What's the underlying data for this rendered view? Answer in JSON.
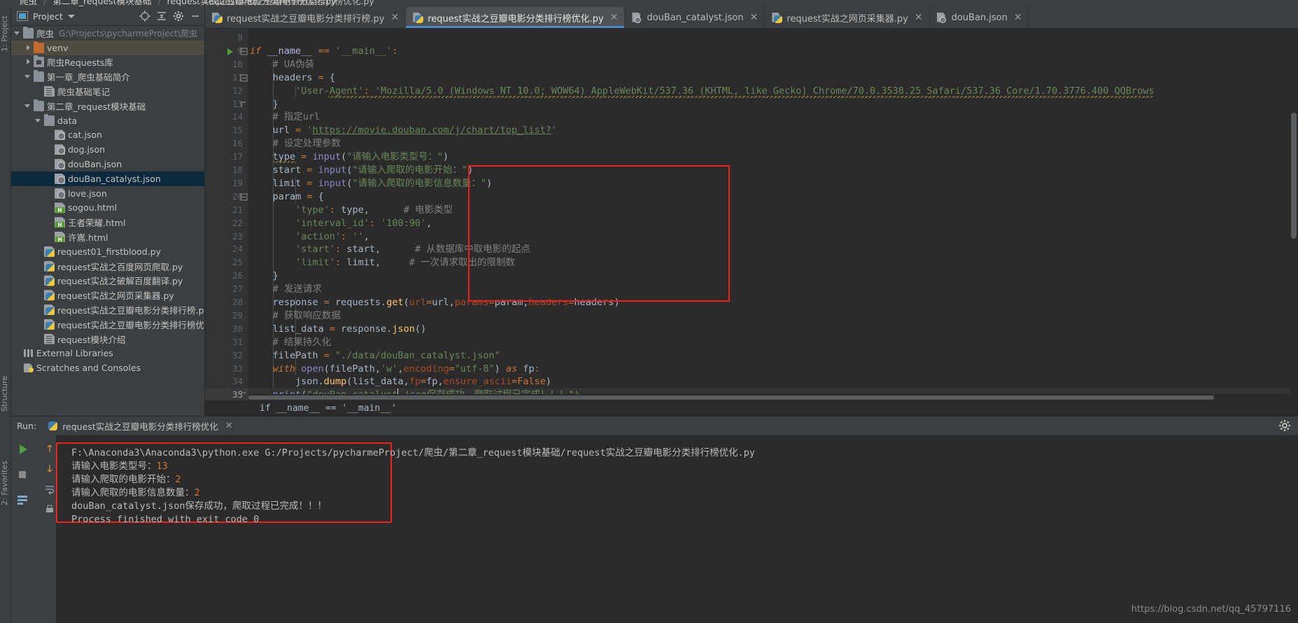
{
  "window": {
    "breadcrumb_top": [
      "爬虫",
      "第二章_request模块基础",
      "request实战之豆瓣电影分类排行榜优化.py"
    ],
    "partial_tab_text": "request实战之豆瓣电影分类排行榜优化.py"
  },
  "project_panel": {
    "title": "Project",
    "toolbar_icons": [
      "locate-icon",
      "collapse-all-icon",
      "gear-icon",
      "minimize-icon"
    ],
    "tree": [
      {
        "indent": 0,
        "arrow": "down",
        "icon": "folder-icon",
        "label": "爬虫",
        "path": "G:\\Projects\\pycharmeProject\\爬虫",
        "state": ""
      },
      {
        "indent": 1,
        "arrow": "right",
        "icon": "folder-orange-icon",
        "label": "venv",
        "path": "",
        "state": "sel-orange"
      },
      {
        "indent": 1,
        "arrow": "right",
        "icon": "folder-source-icon",
        "label": "爬虫Requests库",
        "path": "",
        "state": ""
      },
      {
        "indent": 1,
        "arrow": "down",
        "icon": "folder-icon",
        "label": "第一章_爬虫基础简介",
        "path": "",
        "state": ""
      },
      {
        "indent": 2,
        "arrow": "none",
        "icon": "text-file-icon",
        "label": "爬虫基础笔记",
        "path": "",
        "state": ""
      },
      {
        "indent": 1,
        "arrow": "down",
        "icon": "folder-icon",
        "label": "第二章_request模块基础",
        "path": "",
        "state": ""
      },
      {
        "indent": 2,
        "arrow": "down",
        "icon": "folder-icon",
        "label": "data",
        "path": "",
        "state": ""
      },
      {
        "indent": 3,
        "arrow": "none",
        "icon": "json-file-icon",
        "label": "cat.json",
        "path": "",
        "state": ""
      },
      {
        "indent": 3,
        "arrow": "none",
        "icon": "json-file-icon",
        "label": "dog.json",
        "path": "",
        "state": ""
      },
      {
        "indent": 3,
        "arrow": "none",
        "icon": "json-file-icon",
        "label": "douBan.json",
        "path": "",
        "state": ""
      },
      {
        "indent": 3,
        "arrow": "none",
        "icon": "json-file-icon",
        "label": "douBan_catalyst.json",
        "path": "",
        "state": "sel-blue"
      },
      {
        "indent": 3,
        "arrow": "none",
        "icon": "json-file-icon",
        "label": "love.json",
        "path": "",
        "state": ""
      },
      {
        "indent": 3,
        "arrow": "none",
        "icon": "html-file-icon",
        "label": "sogou.html",
        "path": "",
        "state": ""
      },
      {
        "indent": 3,
        "arrow": "none",
        "icon": "html-file-icon",
        "label": "王者荣耀.html",
        "path": "",
        "state": ""
      },
      {
        "indent": 3,
        "arrow": "none",
        "icon": "html-file-icon",
        "label": "许嵩.html",
        "path": "",
        "state": ""
      },
      {
        "indent": 2,
        "arrow": "none",
        "icon": "python-file-icon",
        "label": "request01_firstblood.py",
        "path": "",
        "state": ""
      },
      {
        "indent": 2,
        "arrow": "none",
        "icon": "python-file-icon",
        "label": "request实战之百度网页爬取.py",
        "path": "",
        "state": ""
      },
      {
        "indent": 2,
        "arrow": "none",
        "icon": "python-file-icon",
        "label": "request实战之破解百度翻译.py",
        "path": "",
        "state": ""
      },
      {
        "indent": 2,
        "arrow": "none",
        "icon": "python-file-icon",
        "label": "request实战之网页采集器.py",
        "path": "",
        "state": ""
      },
      {
        "indent": 2,
        "arrow": "none",
        "icon": "python-file-icon",
        "label": "request实战之豆瓣电影分类排行榜.py",
        "path": "",
        "state": ""
      },
      {
        "indent": 2,
        "arrow": "none",
        "icon": "python-file-icon",
        "label": "request实战之豆瓣电影分类排行榜优化.py",
        "path": "",
        "state": ""
      },
      {
        "indent": 2,
        "arrow": "none",
        "icon": "text-file-icon",
        "label": "request模块介绍",
        "path": "",
        "state": ""
      },
      {
        "indent": 0,
        "arrow": "none",
        "icon": "library-icon",
        "label": "External Libraries",
        "path": "",
        "state": ""
      },
      {
        "indent": 0,
        "arrow": "none",
        "icon": "scratch-icon",
        "label": "Scratches and Consoles",
        "path": "",
        "state": ""
      }
    ]
  },
  "left_rail": {
    "project": "1: Project",
    "structure": "Structure",
    "favorites": "2: Favorites"
  },
  "editor_tabs": [
    {
      "label": "request实战之豆瓣电影分类排行榜.py",
      "icon": "python-file-icon",
      "active": false
    },
    {
      "label": "request实战之豆瓣电影分类排行榜优化.py",
      "icon": "python-file-icon",
      "active": true
    },
    {
      "label": "douBan_catalyst.json",
      "icon": "json-file-icon",
      "active": false
    },
    {
      "label": "request实战之网页采集器.py",
      "icon": "python-file-icon",
      "active": false
    },
    {
      "label": "douBan.json",
      "icon": "json-file-icon",
      "active": false
    }
  ],
  "editor": {
    "first_line_number": 8,
    "current_line": 35,
    "breadcrumb": "if __name__ == '__main__'",
    "lines": [
      {
        "n": 8,
        "text": ""
      },
      {
        "n": 9,
        "text": "if __name__ == '__main__':"
      },
      {
        "n": 10,
        "text": "    # UA伪装"
      },
      {
        "n": 11,
        "text": "    headers = {"
      },
      {
        "n": 12,
        "text": "        'User-Agent': 'Mozilla/5.0 (Windows NT 10.0; WOW64) AppleWebKit/537.36 (KHTML, like Gecko) Chrome/70.0.3538.25 Safari/537.36 Core/1.70.3776.400 QQBrows"
      },
      {
        "n": 13,
        "text": "    }"
      },
      {
        "n": 14,
        "text": "    # 指定url"
      },
      {
        "n": 15,
        "text": "    url = 'https://movie.douban.com/j/chart/top_list?'"
      },
      {
        "n": 16,
        "text": "    # 设定处理参数"
      },
      {
        "n": 17,
        "text": "    type = input(\"请输入电影类型号：\")"
      },
      {
        "n": 18,
        "text": "    start = input(\"请输入爬取的电影开始：\")"
      },
      {
        "n": 19,
        "text": "    limit = input(\"请输入爬取的电影信息数量：\")"
      },
      {
        "n": 20,
        "text": "    param = {"
      },
      {
        "n": 21,
        "text": "        'type': type,      # 电影类型"
      },
      {
        "n": 22,
        "text": "        'interval_id': '100:90',"
      },
      {
        "n": 23,
        "text": "        'action': '',"
      },
      {
        "n": 24,
        "text": "        'start': start,      # 从数据库中取电影的起点"
      },
      {
        "n": 25,
        "text": "        'limit': limit,     # 一次请求取出的限制数"
      },
      {
        "n": 26,
        "text": "    }"
      },
      {
        "n": 27,
        "text": "    # 发送请求"
      },
      {
        "n": 28,
        "text": "    response = requests.get(url=url,params=param,headers=headers)"
      },
      {
        "n": 29,
        "text": "    # 获取响应数据"
      },
      {
        "n": 30,
        "text": "    list_data = response.json()"
      },
      {
        "n": 31,
        "text": "    # 结果持久化"
      },
      {
        "n": 32,
        "text": "    filePath = \"./data/douBan_catalyst.json\""
      },
      {
        "n": 33,
        "text": "    with open(filePath,'w',encoding=\"utf-8\") as fp:"
      },
      {
        "n": 34,
        "text": "        json.dump(list_data,fp=fp,ensure_ascii=False)"
      },
      {
        "n": 35,
        "text": "    print(\"douBan_catalyst.json保存成功，爬取过程已完成！！！\")"
      },
      {
        "n": 36,
        "text": ""
      }
    ]
  },
  "run_panel": {
    "run_label": "Run:",
    "tab_label": "request实战之豆瓣电影分类排行榜优化",
    "left_buttons": [
      "run-icon",
      "stop-icon",
      "rerun-icon",
      "scroll-up-icon",
      "scroll-down-icon",
      "soft-wrap-icon",
      "print-icon"
    ],
    "gear_icon": "settings-icon",
    "console": [
      {
        "kind": "cmd",
        "text": "F:\\Anaconda3\\Anaconda3\\python.exe G:/Projects/pycharmeProject/爬虫/第二章_request模块基础/request实战之豆瓣电影分类排行榜优化.py"
      },
      {
        "kind": "prompt",
        "text": "请输入电影类型号：",
        "value": "13"
      },
      {
        "kind": "prompt",
        "text": "请输入爬取的电影开始：",
        "value": "2"
      },
      {
        "kind": "prompt",
        "text": "请输入爬取的电影信息数量：",
        "value": "2"
      },
      {
        "kind": "out",
        "text": "douBan_catalyst.json保存成功，爬取过程已完成！！！"
      },
      {
        "kind": "out",
        "text": "Process finished with exit code 0"
      }
    ]
  },
  "watermark": "https://blog.csdn.net/qq_45797116",
  "colors": {
    "accent_blue": "#4a88c7",
    "annotation_red": "#f21f1f",
    "selected_row_blue": "#0d293e",
    "selected_row_orange": "#4f4b41",
    "editor_bg": "#2b2b2b",
    "panel_bg": "#3c3f41"
  }
}
